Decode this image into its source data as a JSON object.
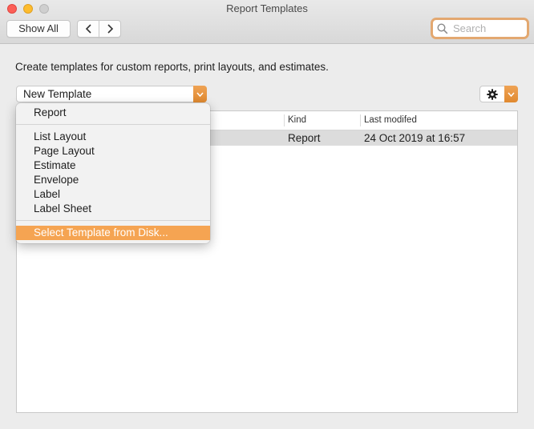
{
  "window": {
    "title": "Report Templates"
  },
  "toolbar": {
    "show_all_label": "Show All",
    "search_placeholder": "Search"
  },
  "description": "Create templates for custom reports, print layouts, and estimates.",
  "new_template": {
    "label": "New Template"
  },
  "table": {
    "columns": [
      "",
      "Kind",
      "Last modifed"
    ],
    "rows": [
      {
        "name": "",
        "kind": "Report",
        "modified": "24 Oct 2019 at 16:57"
      }
    ]
  },
  "menu": {
    "items": [
      "Report",
      "List Layout",
      "Page Layout",
      "Estimate",
      "Envelope",
      "Label",
      "Label Sheet",
      "Select Template from Disk..."
    ],
    "highlighted": "Select Template from Disk..."
  },
  "colors": {
    "accent": "#e58f35",
    "highlight": "#f5a452",
    "search_focus": "#e3a870"
  }
}
